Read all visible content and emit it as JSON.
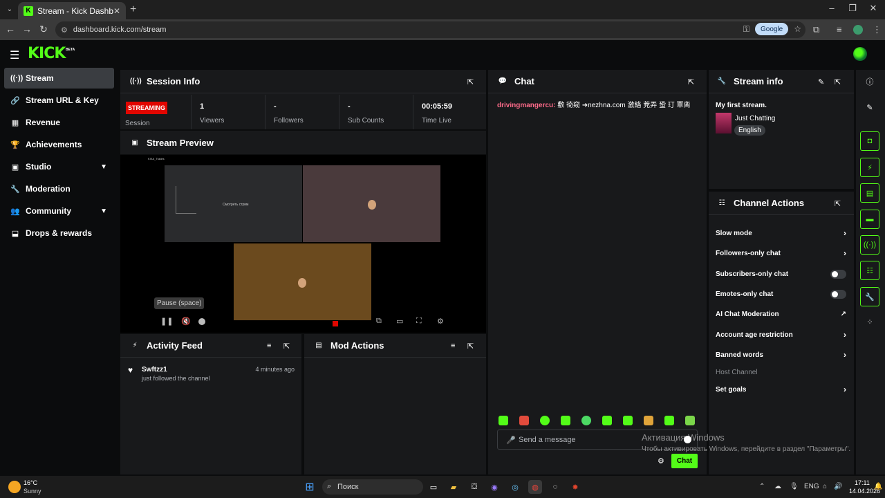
{
  "browser": {
    "tab_title": "Stream - Kick Dashboard",
    "url": "dashboard.kick.com/stream",
    "google_label": "Google"
  },
  "app": {
    "logo": "KICK",
    "beta": "BETA"
  },
  "sidebar": {
    "items": [
      {
        "label": "Stream",
        "icon": "broadcast-icon"
      },
      {
        "label": "Stream URL & Key",
        "icon": "link-icon"
      },
      {
        "label": "Revenue",
        "icon": "revenue-icon"
      },
      {
        "label": "Achievements",
        "icon": "trophy-icon"
      },
      {
        "label": "Studio",
        "icon": "studio-icon"
      },
      {
        "label": "Moderation",
        "icon": "wrench-icon"
      },
      {
        "label": "Community",
        "icon": "community-icon"
      },
      {
        "label": "Drops & rewards",
        "icon": "drops-icon"
      }
    ]
  },
  "session": {
    "title": "Session Info",
    "status": "STREAMING",
    "session_label": "Session",
    "stats": [
      {
        "value": "1",
        "label": "Viewers"
      },
      {
        "value": "-",
        "label": "Followers"
      },
      {
        "value": "-",
        "label": "Sub Counts"
      },
      {
        "value": "00:05:59",
        "label": "Time Live"
      }
    ]
  },
  "preview": {
    "title": "Stream Preview",
    "tooltip": "Pause (space)",
    "tile_a_text": "Смотреть стрим",
    "channel_tag": "KIKA_Trades"
  },
  "activity": {
    "title": "Activity Feed",
    "items": [
      {
        "user": "Swftzz1",
        "action": "just followed the channel",
        "time": "4 minutes ago"
      }
    ]
  },
  "mod_actions": {
    "title": "Mod Actions"
  },
  "chat": {
    "title": "Chat",
    "messages": [
      {
        "user": "drivingmangercu:",
        "text": "敷 徛窥 ➜nezhna.com 激絡 茺弄 蛩 玎 覃脔"
      }
    ],
    "placeholder": "Send a message",
    "send_label": "Chat"
  },
  "stream_info": {
    "title": "Stream info",
    "stream_title": "My first stream.",
    "category": "Just Chatting",
    "language": "English"
  },
  "channel_actions": {
    "title": "Channel Actions",
    "items": [
      {
        "label": "Slow mode",
        "control": "chevron"
      },
      {
        "label": "Followers-only chat",
        "control": "chevron"
      },
      {
        "label": "Subscribers-only chat",
        "control": "toggle"
      },
      {
        "label": "Emotes-only chat",
        "control": "toggle"
      },
      {
        "label": "AI Chat Moderation",
        "control": "external"
      },
      {
        "label": "Account age restriction",
        "control": "chevron"
      },
      {
        "label": "Banned words",
        "control": "chevron"
      },
      {
        "label": "Host Channel",
        "control": "none"
      },
      {
        "label": "Set goals",
        "control": "chevron"
      }
    ]
  },
  "windows_activation": {
    "line1": "Активация Windows",
    "line2": "Чтобы активировать Windows, перейдите в раздел \"Параметры\"."
  },
  "taskbar": {
    "temp": "16°C",
    "weather": "Sunny",
    "search": "Поиск",
    "lang": "ENG",
    "time": "17:11",
    "date": "14.04.2026"
  },
  "colors": {
    "accent": "#53fc18",
    "live_badge": "#e10600",
    "panel": "#18191b",
    "page": "#0b0c0d"
  }
}
